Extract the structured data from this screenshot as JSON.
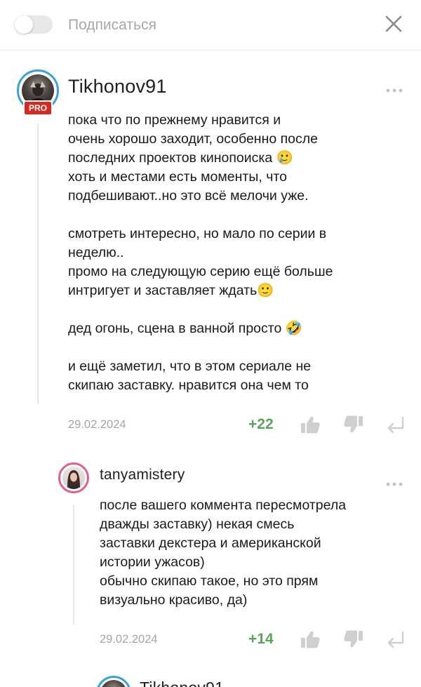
{
  "header": {
    "subscribe_label": "Подписаться"
  },
  "comments": [
    {
      "username": "Tikhonov91",
      "badge": "PRO",
      "text": "пока что по прежнему нравится и\nочень хорошо заходит, особенно после\nпоследних проектов кинопоиска 🥲\nхоть и местами есть моменты, что\nподбешивают..но это всё мелочи уже.\n\nсмотреть интересно, но мало по серии в\nнеделю..\nпромо на следующую серию ещё больше\nинтригует и заставляет ждать🙂\n\nдед огонь, сцена в ванной просто 🤣\n\nи ещё заметил, что в этом сериале не\nскипаю заставку. нравится она чем то",
      "date": "29.02.2024",
      "score": "+22"
    },
    {
      "username": "tanyamistery",
      "text": "после вашего коммента пересмотрела\nдважды заставку) некая смесь\nзаставки декстера и американской\nистории ужасов)\nобычно скипаю такое, но это прям\nвизуально красиво, да)",
      "date": "29.02.2024",
      "score": "+14"
    },
    {
      "username": "Tikhonov91"
    }
  ],
  "icons": {
    "like": "thumbs-up-icon",
    "dislike": "thumbs-down-icon",
    "reply": "reply-arrow-icon",
    "more": "more-dots-icon",
    "close": "close-icon"
  },
  "colors": {
    "score_positive": "#5aa35a",
    "pro_badge": "#d9281f",
    "avatar_ring_primary": "#3aa0d8",
    "avatar_ring_secondary": "#e0608a"
  }
}
